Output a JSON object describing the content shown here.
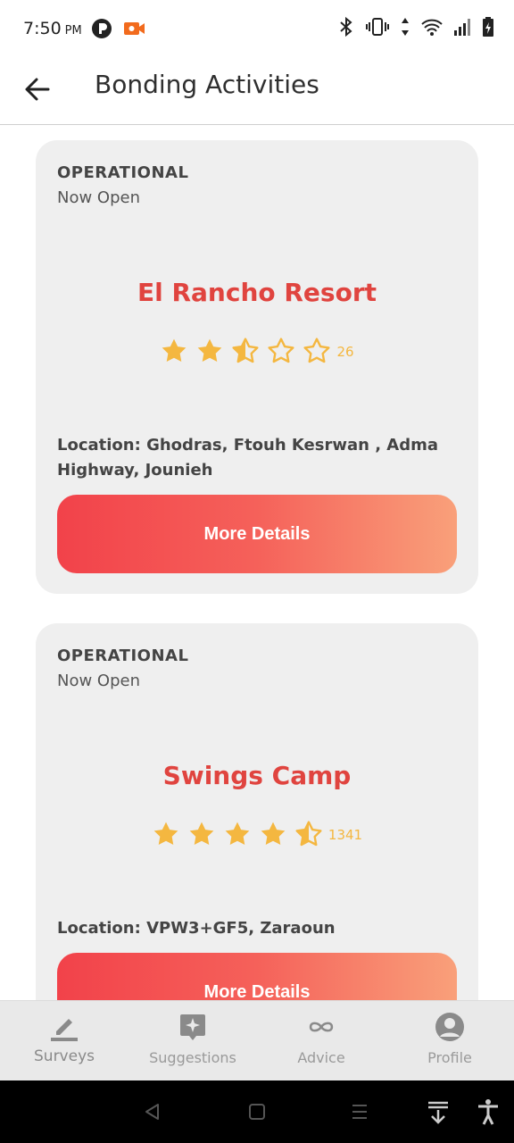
{
  "status_bar": {
    "time": "7:50",
    "ampm": "PM"
  },
  "header": {
    "title": "Bonding Activities"
  },
  "cards": [
    {
      "status": "OPERATIONAL",
      "open_text": "Now Open",
      "name": "El Rancho Resort",
      "rating": 2.5,
      "review_count": "26",
      "location_line1": "Location: Ghodras, Ftouh Kesrwan , Adma",
      "location_line2": "Highway, Jounieh",
      "button_label": "More Details"
    },
    {
      "status": "OPERATIONAL",
      "open_text": "Now Open",
      "name": "Swings Camp",
      "rating": 4.5,
      "review_count": "1341",
      "location_line1": "Location: VPW3+GF5, Zaraoun",
      "button_label": "More Details"
    }
  ],
  "bottom_nav": {
    "items": [
      {
        "label": "Surveys",
        "icon": "pencil-icon"
      },
      {
        "label": "Suggestions",
        "icon": "sparkle-icon"
      },
      {
        "label": "Advice",
        "icon": "infinity-icon"
      },
      {
        "label": "Profile",
        "icon": "user-icon"
      }
    ]
  },
  "colors": {
    "accent_red": "#e0443f",
    "star": "#f4b740",
    "card_bg": "#efefef"
  }
}
